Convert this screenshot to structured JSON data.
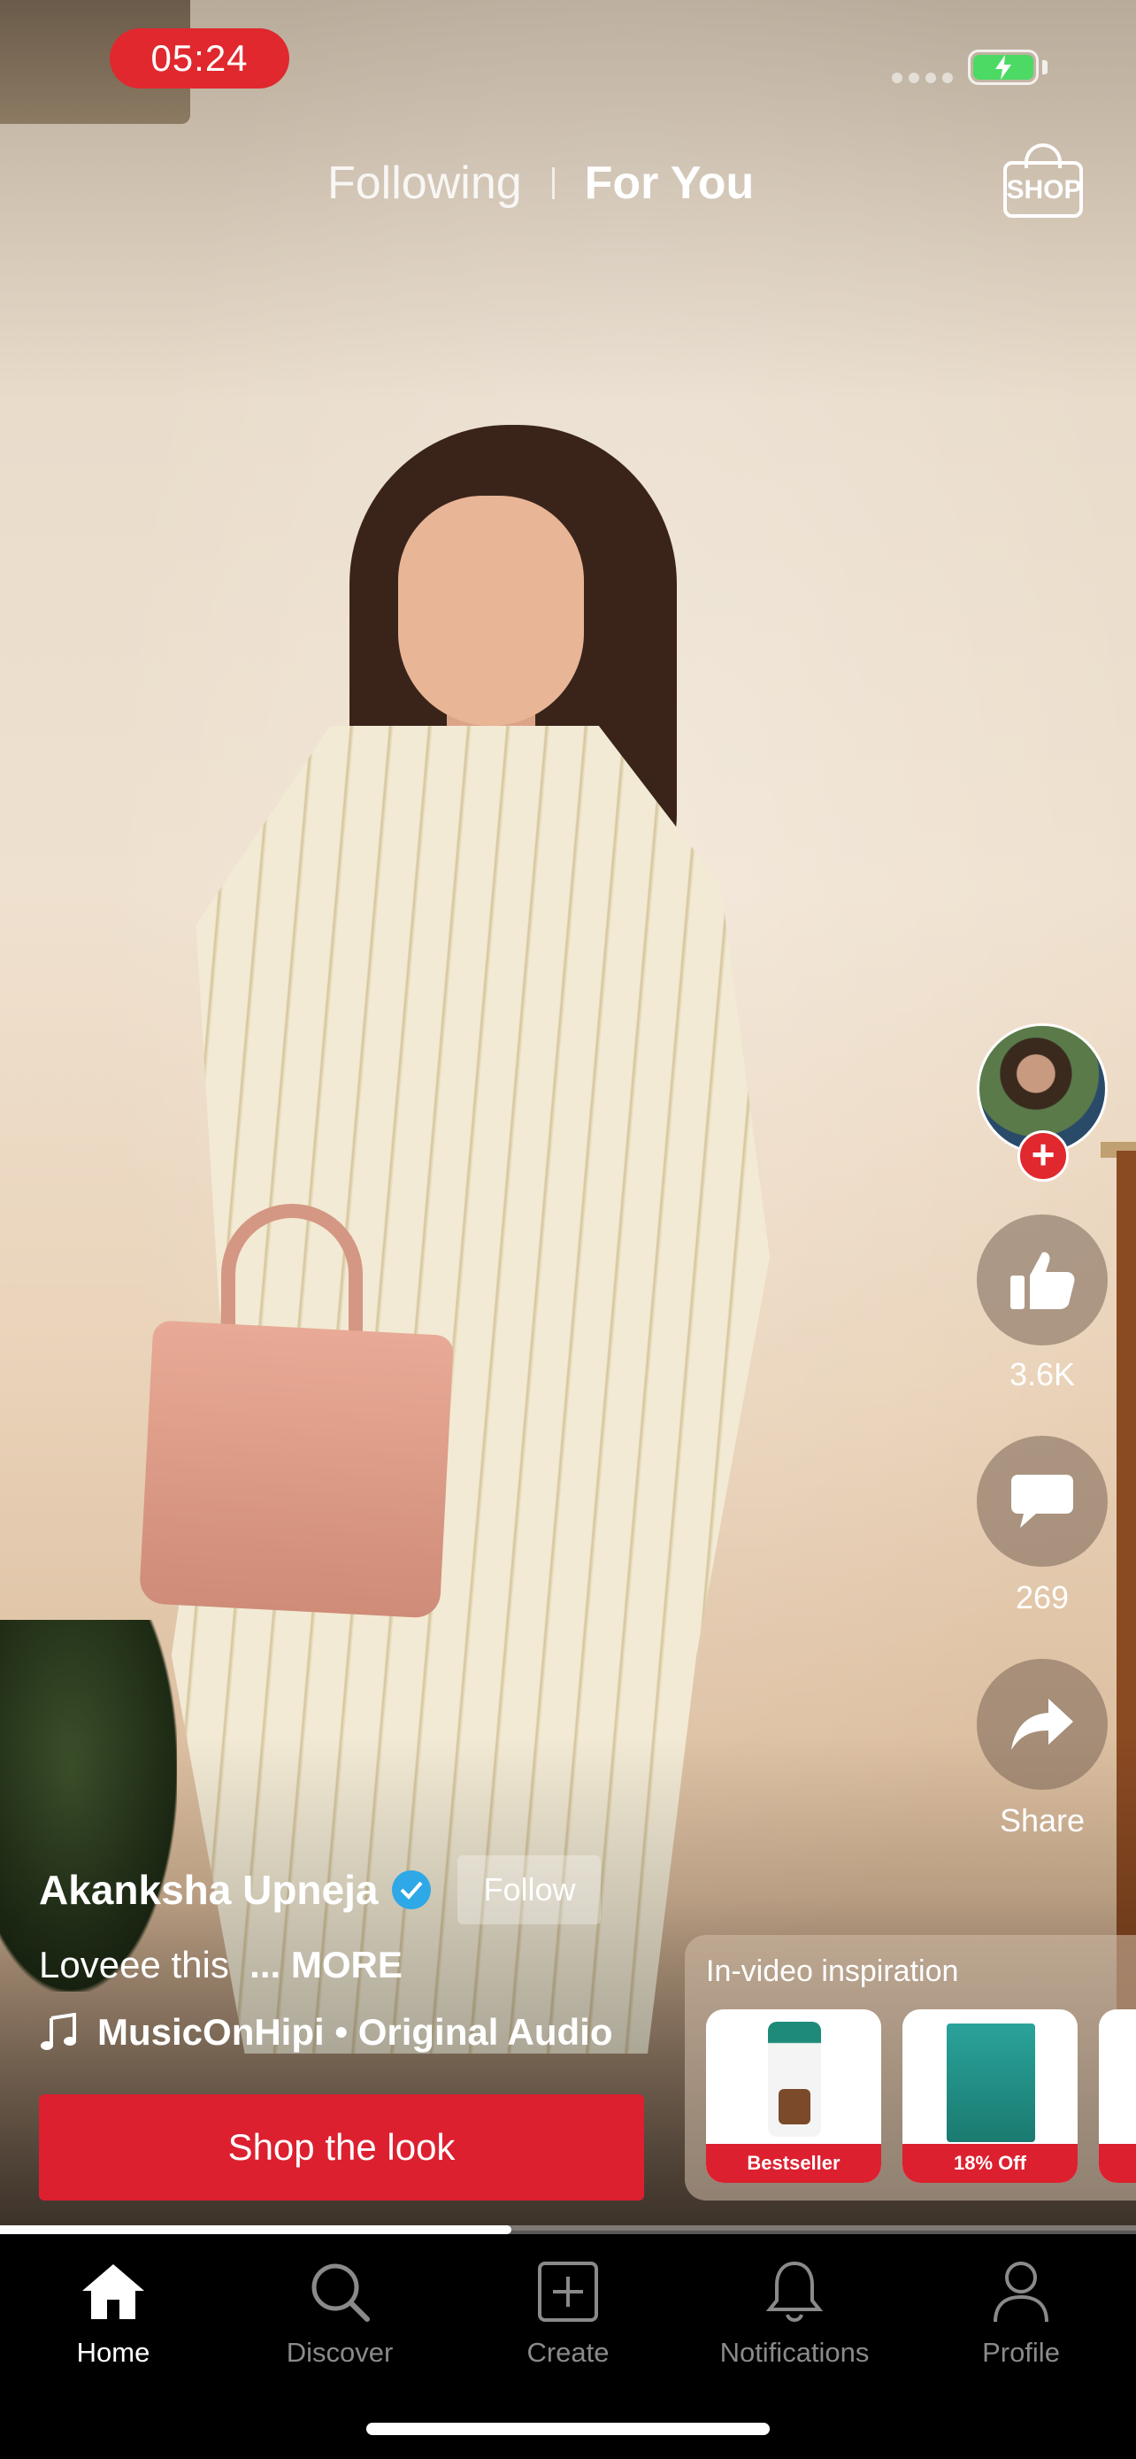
{
  "status_bar": {
    "time": "05:24",
    "battery_state": "charging"
  },
  "top_tabs": [
    {
      "label": "Following",
      "active": false
    },
    {
      "label": "For You",
      "active": true
    }
  ],
  "shop_button": {
    "label": "SHOP"
  },
  "rail": {
    "likes": "3.6K",
    "comments": "269",
    "share_label": "Share"
  },
  "post": {
    "username": "Akanksha Upneja",
    "verified": true,
    "follow_label": "Follow",
    "caption": "Loveee this",
    "more_label": "... MORE",
    "audio": "MusicOnHipi • Original Audio",
    "shop_look_label": "Shop the look"
  },
  "inspiration": {
    "title": "In-video inspiration",
    "products": [
      {
        "badge": "Bestseller"
      },
      {
        "badge": "18% Off"
      }
    ]
  },
  "video_progress": 0.45,
  "nav": [
    {
      "label": "Home",
      "icon": "home-icon",
      "active": true
    },
    {
      "label": "Discover",
      "icon": "search-icon",
      "active": false
    },
    {
      "label": "Create",
      "icon": "plus-square-icon",
      "active": false
    },
    {
      "label": "Notifications",
      "icon": "bell-icon",
      "active": false
    },
    {
      "label": "Profile",
      "icon": "person-icon",
      "active": false
    }
  ],
  "colors": {
    "accent": "#dc2030",
    "verified": "#2ea8e6"
  }
}
